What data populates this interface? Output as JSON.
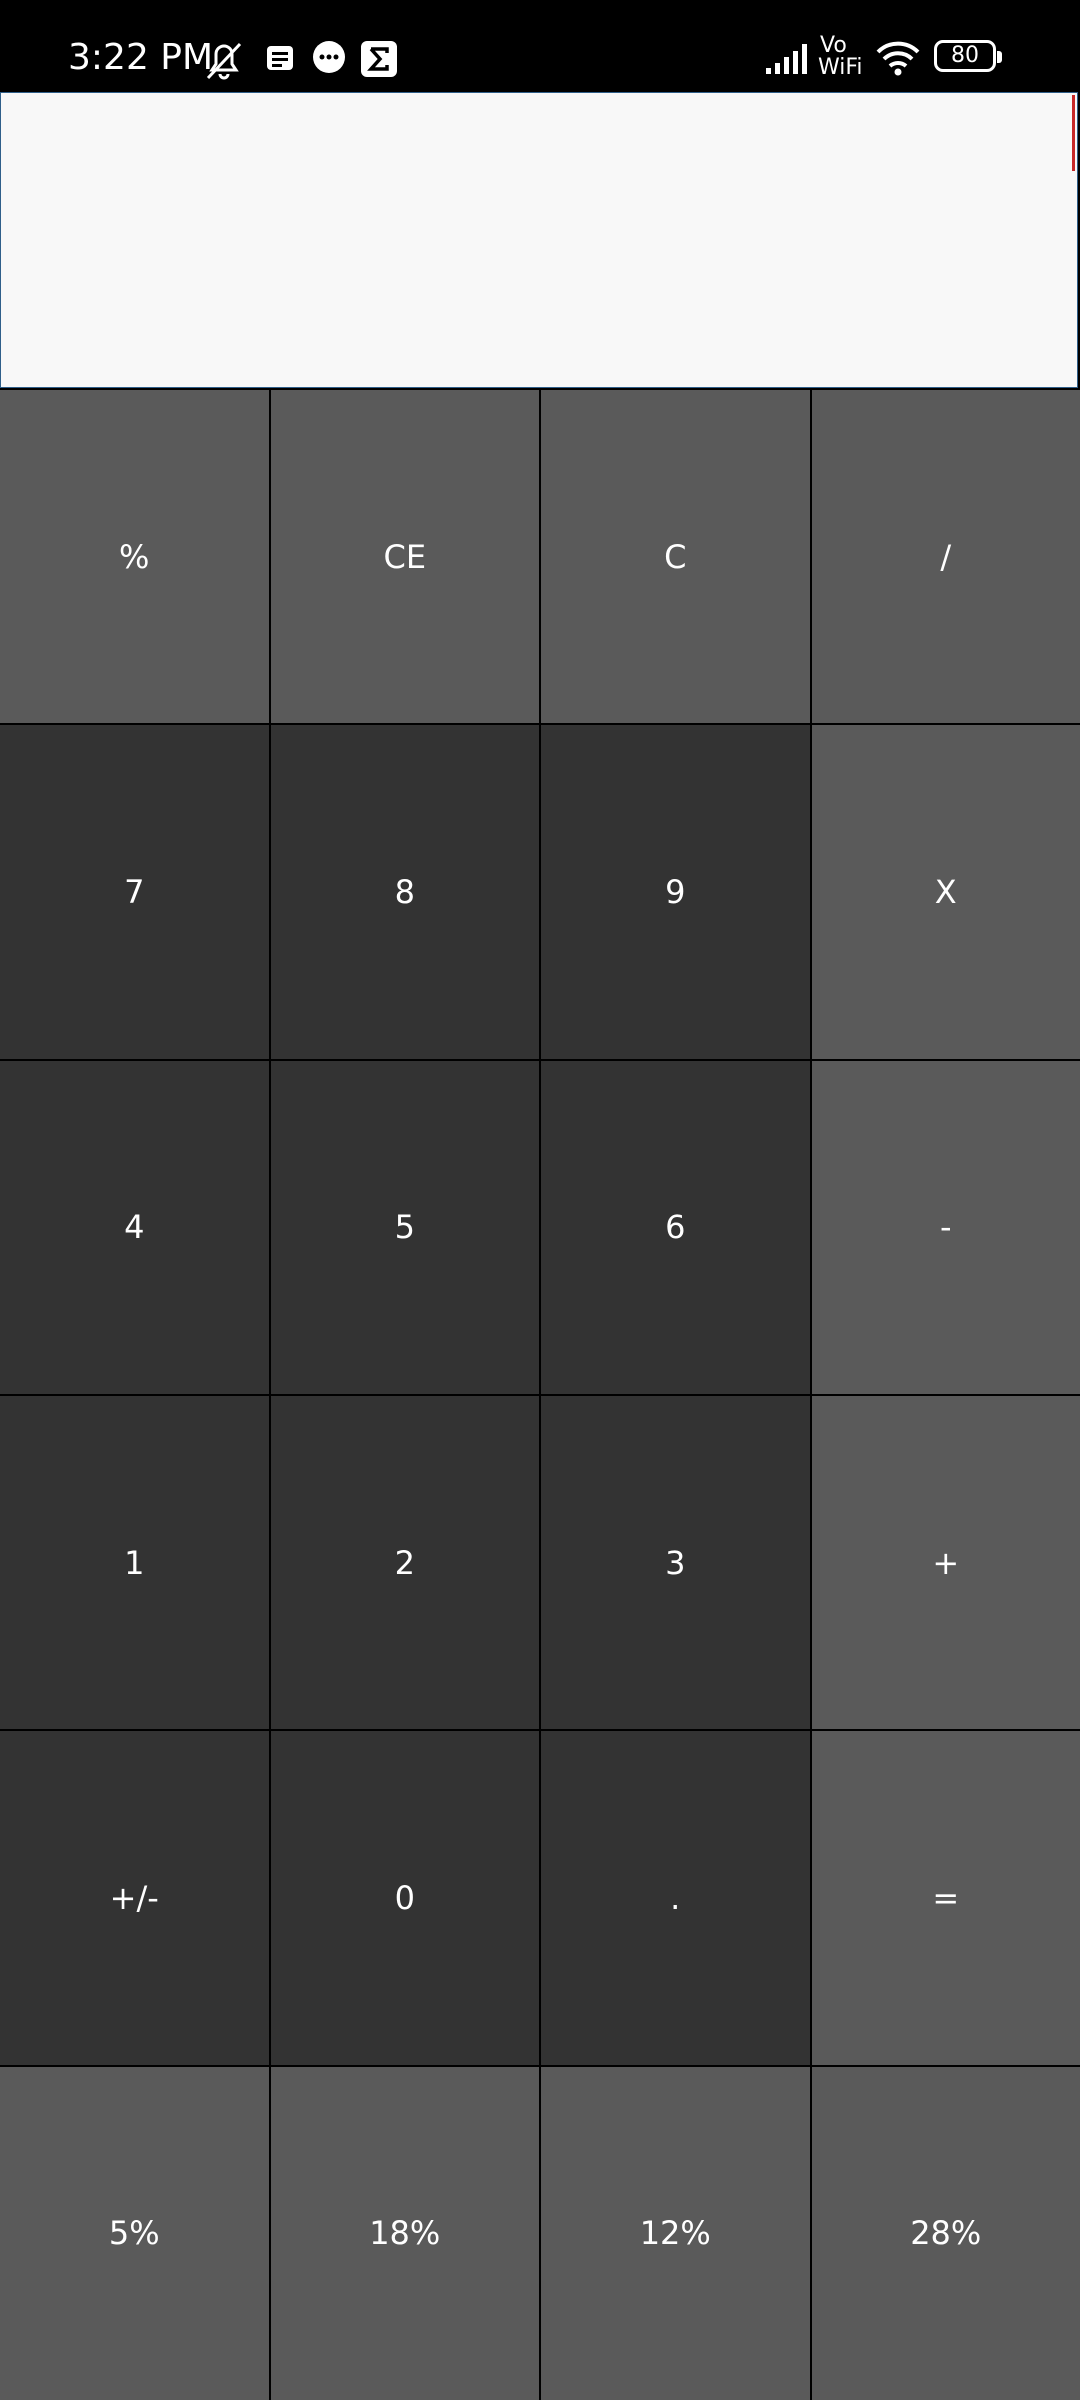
{
  "status_bar": {
    "time": "3:22 PM",
    "network_label_top": "Vo",
    "network_label_bottom": "WiFi",
    "battery": "80",
    "icons": [
      "mute-icon",
      "notes-icon",
      "message-icon",
      "sigma-icon",
      "signal-icon",
      "wifi-icon",
      "battery-icon"
    ]
  },
  "display": {
    "value": ""
  },
  "colors": {
    "number_key": "#333333",
    "function_key": "#5a5a5a",
    "display_bg": "#f8f8f8",
    "cursor": "#c62828"
  },
  "keypad": {
    "rows": [
      [
        "%",
        "CE",
        "C",
        "/"
      ],
      [
        "7",
        "8",
        "9",
        "X"
      ],
      [
        "4",
        "5",
        "6",
        "-"
      ],
      [
        "1",
        "2",
        "3",
        "+"
      ],
      [
        "+/-",
        "0",
        ".",
        "="
      ],
      [
        "5%",
        "18%",
        "12%",
        "28%"
      ]
    ]
  }
}
